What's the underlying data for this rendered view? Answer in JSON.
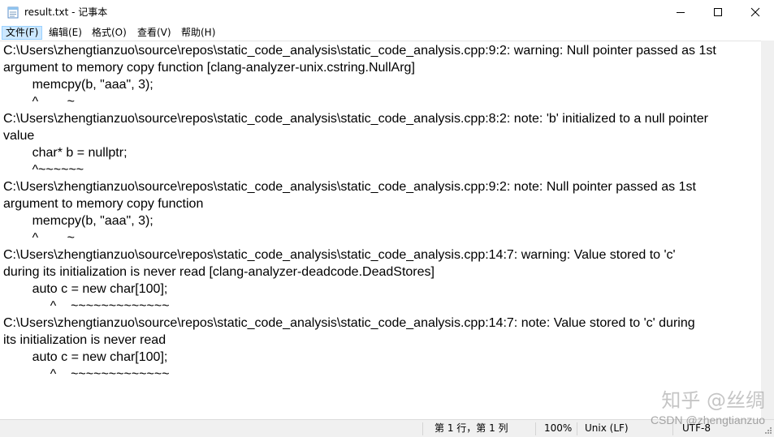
{
  "window": {
    "title": "result.txt - 记事本",
    "icon": "notepad-icon",
    "controls": [
      "minimize-icon",
      "maximize-icon",
      "close-icon"
    ]
  },
  "menu": {
    "items": [
      "文件(F)",
      "编辑(E)",
      "格式(O)",
      "查看(V)",
      "帮助(H)"
    ],
    "active_index": 0
  },
  "editor": {
    "lines": [
      "C:\\Users\\zhengtianzuo\\source\\repos\\static_code_analysis\\static_code_analysis.cpp:9:2: warning: Null pointer passed as 1st",
      "argument to memory copy function [clang-analyzer-unix.cstring.NullArg]",
      "        memcpy(b, \"aaa\", 3);",
      "        ^        ~",
      "C:\\Users\\zhengtianzuo\\source\\repos\\static_code_analysis\\static_code_analysis.cpp:8:2: note: 'b' initialized to a null pointer",
      "value",
      "        char* b = nullptr;",
      "        ^~~~~~~",
      "C:\\Users\\zhengtianzuo\\source\\repos\\static_code_analysis\\static_code_analysis.cpp:9:2: note: Null pointer passed as 1st",
      "argument to memory copy function",
      "        memcpy(b, \"aaa\", 3);",
      "        ^        ~",
      "C:\\Users\\zhengtianzuo\\source\\repos\\static_code_analysis\\static_code_analysis.cpp:14:7: warning: Value stored to 'c'",
      "during its initialization is never read [clang-analyzer-deadcode.DeadStores]",
      "        auto c = new char[100];",
      "             ^    ~~~~~~~~~~~~~",
      "C:\\Users\\zhengtianzuo\\source\\repos\\static_code_analysis\\static_code_analysis.cpp:14:7: note: Value stored to 'c' during",
      "its initialization is never read",
      "        auto c = new char[100];",
      "             ^    ~~~~~~~~~~~~~"
    ]
  },
  "status": {
    "position": "第 1 行，第 1 列",
    "zoom": "100%",
    "line_ending": "Unix (LF)",
    "encoding": "UTF-8"
  },
  "watermark": {
    "line1": "知乎 @丝绸",
    "line2": "CSDN @zhengtianzuo"
  }
}
